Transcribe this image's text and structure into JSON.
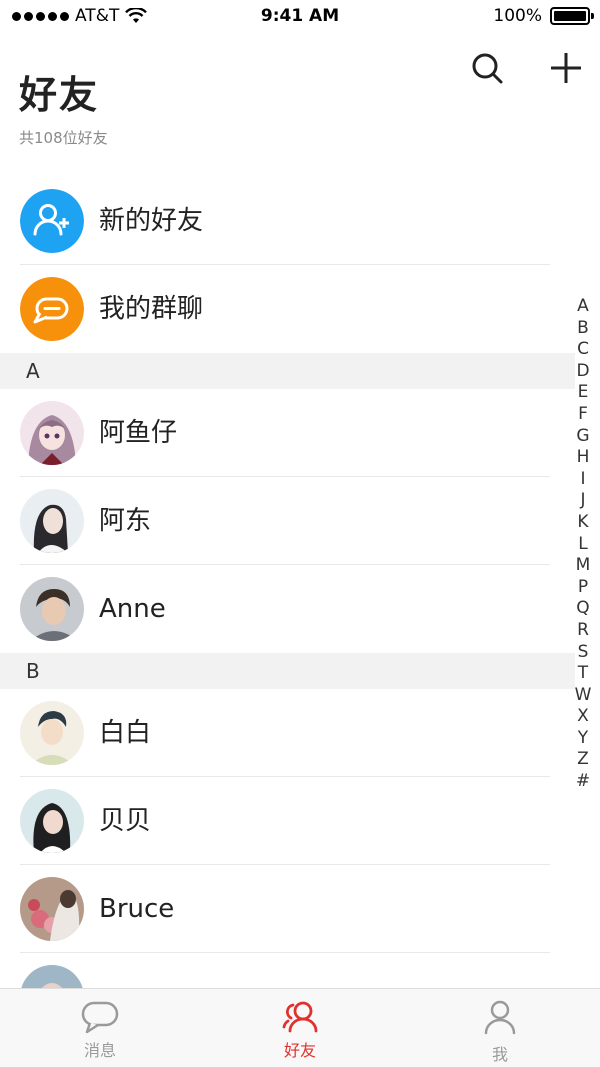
{
  "status_bar": {
    "carrier": "AT&T",
    "time": "9:41 AM",
    "battery": "100%"
  },
  "header": {
    "title": "好友",
    "subtitle": "共108位好友"
  },
  "icons": {
    "search": "search-icon",
    "add": "plus-icon"
  },
  "quick_items": [
    {
      "label": "新的好友",
      "icon": "add-user-icon",
      "color": "#1ea3f3"
    },
    {
      "label": "我的群聊",
      "icon": "chat-bubbles-icon",
      "color": "#f7900a"
    }
  ],
  "sections": [
    {
      "letter": "A",
      "contacts": [
        {
          "name": "阿鱼仔"
        },
        {
          "name": "阿东"
        },
        {
          "name": "Anne"
        }
      ]
    },
    {
      "letter": "B",
      "contacts": [
        {
          "name": "白白"
        },
        {
          "name": "贝贝"
        },
        {
          "name": "Bruce"
        }
      ]
    }
  ],
  "index_letters": [
    "A",
    "B",
    "C",
    "D",
    "E",
    "F",
    "G",
    "H",
    "I",
    "J",
    "K",
    "L",
    "M",
    "P",
    "Q",
    "R",
    "S",
    "T",
    "W",
    "X",
    "Y",
    "Z",
    "#"
  ],
  "tabbar": {
    "tabs": [
      {
        "label": "消息",
        "icon": "message-icon"
      },
      {
        "label": "好友",
        "icon": "friends-icon",
        "active": true
      },
      {
        "label": "我",
        "icon": "profile-icon"
      }
    ]
  },
  "colors": {
    "accent": "#e0312e",
    "inactive": "#9a9a9a",
    "section_bg": "#f2f2f2"
  }
}
